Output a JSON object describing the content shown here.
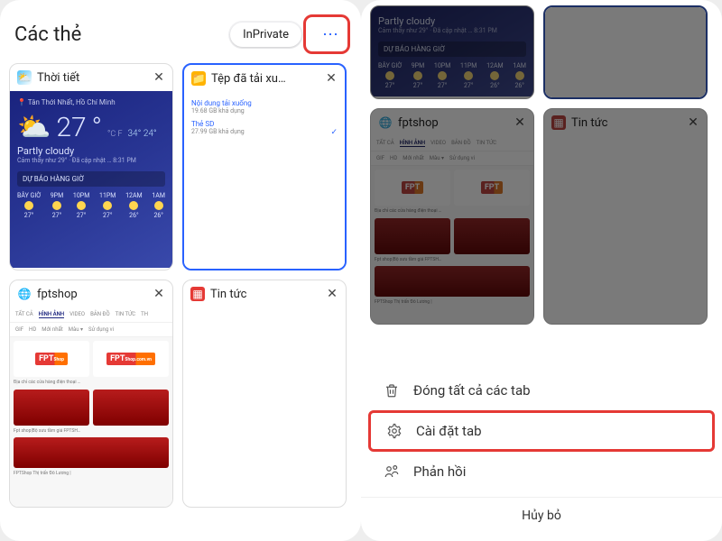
{
  "left": {
    "header_title": "Các thẻ",
    "pill_active": "InPrivate",
    "tabs": [
      {
        "title": "Thời tiết",
        "icon": "weather",
        "preview": {
          "type": "weather",
          "location": "Tân Thới Nhất, Hồ Chí Minh",
          "temp": "27",
          "unit1": "°C",
          "unit2": "F",
          "hi": "34°",
          "lo": "24°",
          "condition": "Partly cloudy",
          "updated": "Cảm thấy như 29° · Đã cập nhật … 8:31 PM",
          "band_label": "DỰ BÁO HÀNG GIỜ",
          "hours_labels": [
            "BÂY GIỜ",
            "9PM",
            "10PM",
            "11PM",
            "12AM",
            "1AM"
          ],
          "hours_temps": [
            "27°",
            "27°",
            "27°",
            "27°",
            "26°",
            "26°"
          ]
        }
      },
      {
        "title": "Tệp đã tải xu…",
        "icon": "folder",
        "selected": true,
        "preview": {
          "type": "downloads",
          "rows": [
            {
              "label": "Nội dung tải xuống",
              "sub": "19.68 GB khả dụng"
            },
            {
              "label": "Thẻ SD",
              "sub": "27.99 GB khả dụng"
            }
          ]
        }
      },
      {
        "title": "fptshop",
        "icon": "globe",
        "preview": {
          "type": "image-results",
          "tabs": [
            "TẤT CẢ",
            "HÌNH ẢNH",
            "VIDEO",
            "BẢN ĐỒ",
            "TIN TỨC",
            "TH"
          ],
          "tabs_active": "HÌNH ẢNH",
          "sub_filters": [
            "GIF",
            "HD",
            "Mới nhất",
            "Màu ▾",
            "Sử dụng vi"
          ],
          "caption1": "Địa chỉ các cửa hàng điện thoại …",
          "caption2": "Fpt shop|Bộ sưu tầm giá FPTSH…",
          "caption3": "FPTShop Thị trấn Đô Lương |"
        }
      },
      {
        "title": "Tin tức",
        "icon": "news",
        "preview": {
          "type": "blank"
        }
      }
    ]
  },
  "right": {
    "tabs_row2": [
      {
        "title": "fptshop",
        "icon": "globe"
      },
      {
        "title": "Tin tức",
        "icon": "news"
      }
    ],
    "sheet": {
      "close_all": "Đóng tất cả các tab",
      "tab_settings": "Cài đặt tab",
      "feedback": "Phản hồi",
      "cancel": "Hủy bỏ"
    }
  }
}
